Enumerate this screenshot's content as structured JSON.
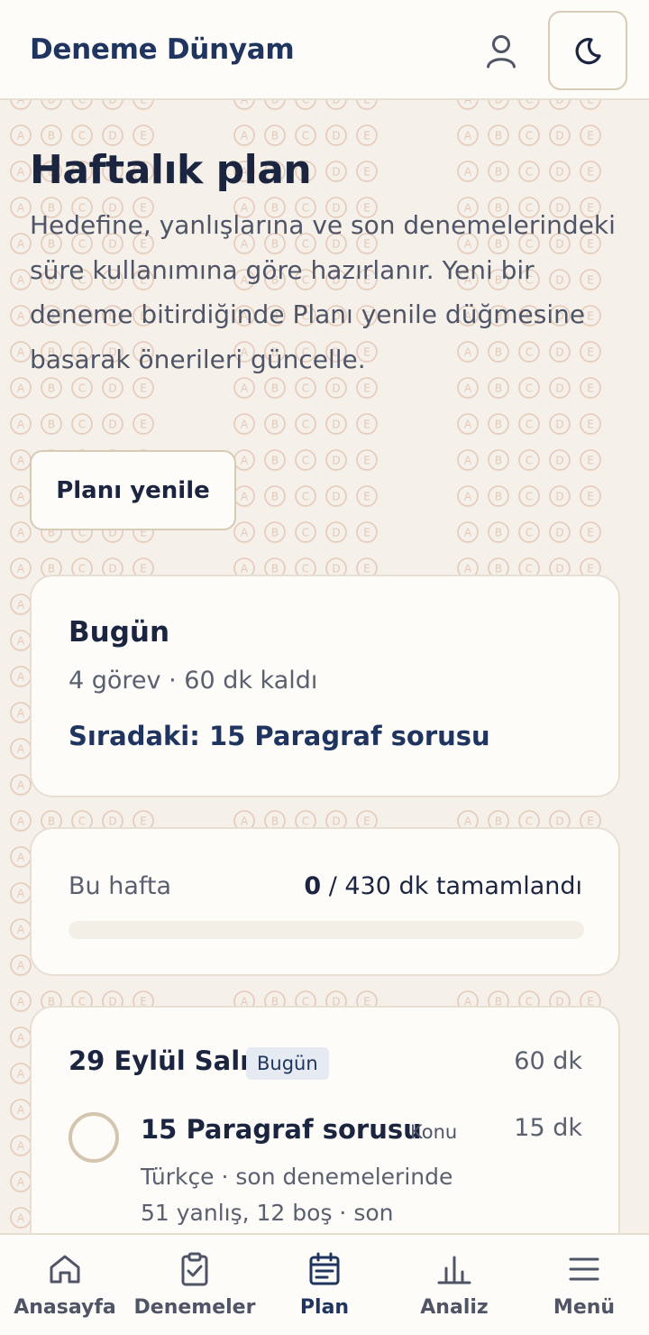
{
  "header": {
    "brand": "Deneme Dünyam",
    "user_icon": "user-icon",
    "theme_icon": "moon-icon"
  },
  "page": {
    "title": "Haftalık plan",
    "intro": "Hedefine, yanlışlarına ve son denemelerindeki süre kullanımına göre hazırlanır. Yeni bir deneme bitirdiğinde Planı yenile düğmesine basarak önerileri güncelle.",
    "refresh_label": "Planı yenile"
  },
  "today_card": {
    "title": "Bugün",
    "summary": "4 görev · 60 dk kaldı",
    "next": "Sıradaki: 15 Paragraf sorusu"
  },
  "week_card": {
    "label": "Bu hafta",
    "done": "0",
    "rest": " / 430 dk tamamlandı",
    "progress_fraction": 0
  },
  "day_card": {
    "date": "29 Eylül Salı",
    "badge": "Bugün",
    "total": "60 dk",
    "task": {
      "title": "15 Paragraf sorusu",
      "tag": "Konu",
      "duration": "15 dk",
      "description": "Türkçe · son denemelerinde 51 yanlış, 12 boş · son"
    }
  },
  "nav": {
    "items": [
      {
        "label": "Anasayfa",
        "icon": "home-icon"
      },
      {
        "label": "Denemeler",
        "icon": "clipboard-check-icon"
      },
      {
        "label": "Plan",
        "icon": "calendar-icon",
        "active": true
      },
      {
        "label": "Analiz",
        "icon": "bar-chart-icon"
      },
      {
        "label": "Menü",
        "icon": "hamburger-menu-icon"
      }
    ]
  },
  "pattern": {
    "letters": [
      "A",
      "B",
      "C",
      "D",
      "E"
    ],
    "color": "#e4c9b8"
  },
  "colors": {
    "brand": "#1f3560",
    "background": "#f5f1ea",
    "card": "#fdfcf9",
    "border": "#e6dfd2"
  }
}
